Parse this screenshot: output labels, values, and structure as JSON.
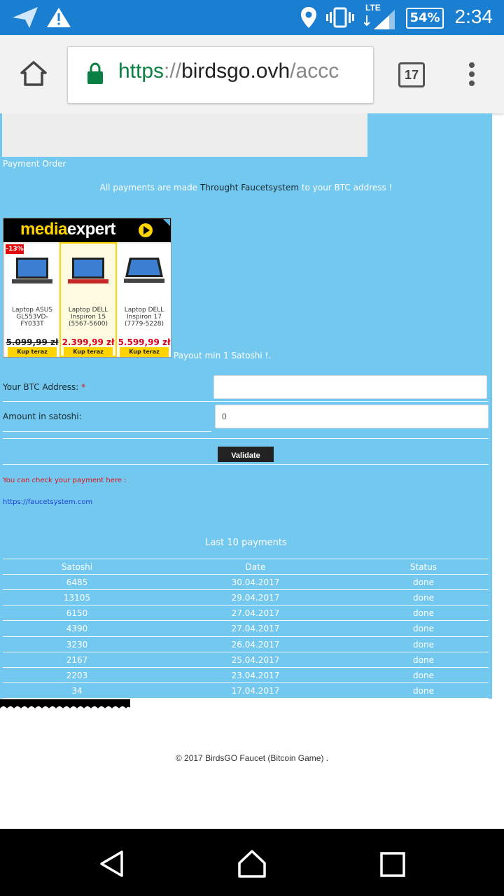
{
  "status_bar": {
    "time": "2:34",
    "battery": "54%",
    "network": "LTE",
    "icons": [
      "navigation-icon",
      "warning-icon",
      "location-icon",
      "vibrate-icon",
      "signal-icon",
      "battery-icon"
    ]
  },
  "browser": {
    "url_protocol": "https",
    "url_separator": "://",
    "url_host": "birdsgo.ovh",
    "url_path": "/accc",
    "tab_count": "17"
  },
  "page": {
    "payment_order_label": "Payment Order",
    "info_prefix": "All payments are made",
    "info_link": "Throught Faucetsystem",
    "info_suffix": "to your BTC address !",
    "payout_min": "Payout min 1 Satoshi !.",
    "btc_label": "Your BTC Address:",
    "required_mark": "*",
    "amount_label": "Amount in satoshi:",
    "amount_value": "0",
    "validate_label": "Validate",
    "check_payment": "You can check your payment here :",
    "faucet_link": "https://faucetsystem.com",
    "last_payments_title": "Last 10 payments"
  },
  "ad": {
    "brand_part1": "media",
    "brand_part2": "expert",
    "discount": "-13%",
    "products": [
      {
        "name": "Laptop ASUS GL553VD-FY033T",
        "price": "5.099,99 zł",
        "button": "Kup teraz"
      },
      {
        "name": "Laptop DELL Inspiron 15 (5567-5600)",
        "price": "2.399,99 zł",
        "button": "Kup teraz"
      },
      {
        "name": "Laptop DELL Inspiron 17 (7779-5228)",
        "price": "5.599,99 zł",
        "button": "Kup teraz"
      }
    ]
  },
  "payments": {
    "headers": [
      "Satoshi",
      "Date",
      "Status"
    ],
    "rows": [
      [
        "6485",
        "30.04.2017",
        "done"
      ],
      [
        "13105",
        "29.04.2017",
        "done"
      ],
      [
        "6150",
        "27.04.2017",
        "done"
      ],
      [
        "4390",
        "27.04.2017",
        "done"
      ],
      [
        "3230",
        "26.04.2017",
        "done"
      ],
      [
        "2167",
        "25.04.2017",
        "done"
      ],
      [
        "2203",
        "23.04.2017",
        "done"
      ],
      [
        "34",
        "17.04.2017",
        "done"
      ]
    ]
  },
  "footer": {
    "text": "© 2017 BirdsGO Faucet (Bitcoin Game) ."
  },
  "colors": {
    "status_bar": "#1a7fd0",
    "page_background": "#72c8ee",
    "url_secure": "#0b8043",
    "link_red": "#e0101a",
    "link_blue": "#1a3fd6"
  }
}
